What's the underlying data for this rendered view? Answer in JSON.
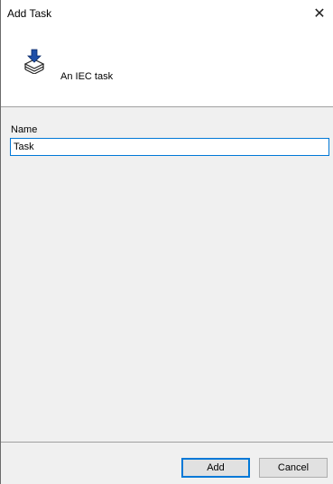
{
  "window": {
    "title": "Add Task",
    "close_glyph": "✕"
  },
  "header": {
    "icon": "iec-task-icon",
    "description": "An IEC task"
  },
  "form": {
    "name_label": "Name",
    "name_value": "Task"
  },
  "buttons": {
    "add_label": "Add",
    "cancel_label": "Cancel"
  },
  "colors": {
    "accent": "#0078d7",
    "dialog_background": "#f0f0f0",
    "header_background": "#ffffff"
  }
}
